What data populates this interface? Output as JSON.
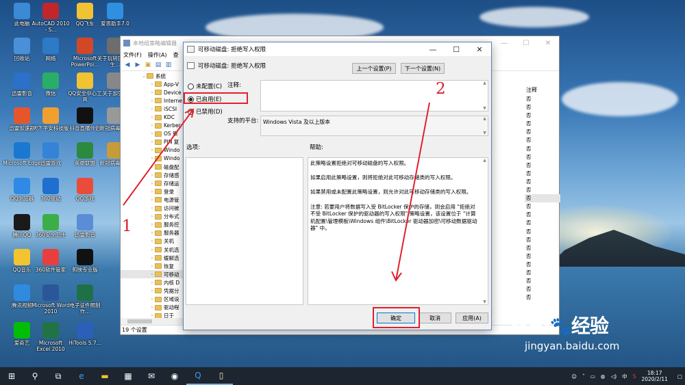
{
  "desktop": {
    "icons": [
      {
        "label": "此电脑",
        "color": "#3a8ad6"
      },
      {
        "label": "AutoCAD 2010 - S...",
        "color": "#c0262c"
      },
      {
        "label": "QQ飞车",
        "color": "#f1c232"
      },
      {
        "label": "爱思助手7.0",
        "color": "#2f8fe0"
      },
      {
        "label": "回收站",
        "color": "#4a90d9"
      },
      {
        "label": "网络",
        "color": "#2d7ac7"
      },
      {
        "label": "Microsoft PowerPoi...",
        "color": "#d24726"
      },
      {
        "label": "关于玩转国际卫生...",
        "color": "#6d6d6d"
      },
      {
        "label": "迅雷影音",
        "color": "#2b70c9"
      },
      {
        "label": "微信",
        "color": "#2aae67"
      },
      {
        "label": "QQ安全中心工具",
        "color": "#f1c232"
      },
      {
        "label": "关于加强...",
        "color": "#888888"
      },
      {
        "label": "迅雷加速器",
        "color": "#e5572a"
      },
      {
        "label": "天下平安科技版",
        "color": "#f0a030"
      },
      {
        "label": "抖音直播伴侣",
        "color": "#111111"
      },
      {
        "label": "新冠病毒疫...",
        "color": "#999999"
      },
      {
        "label": "Microsoft Edge",
        "color": "#1b78d1"
      },
      {
        "label": "迅雷游戏",
        "color": "#3483d6"
      },
      {
        "label": "英雄联盟",
        "color": "#2b8a3e"
      },
      {
        "label": "新冠病毒疫...",
        "color": "#c89b3a"
      },
      {
        "label": "QQ浏览器",
        "color": "#2e8ae6"
      },
      {
        "label": "360驱动",
        "color": "#1e6fcf"
      },
      {
        "label": "QQ游戏",
        "color": "#e94d3a"
      },
      {
        "label": "腾讯QQ",
        "color": "#1a1a1a"
      },
      {
        "label": "360安全卫士",
        "color": "#3cae48"
      },
      {
        "label": "迅雷影音",
        "color": "#5b8dd6"
      },
      {
        "label": "QQ音乐",
        "color": "#f4c430"
      },
      {
        "label": "360软件管家",
        "color": "#e83e3e"
      },
      {
        "label": "剪映专业版",
        "color": "#111111"
      },
      {
        "label": "腾讯视频",
        "color": "#2f8ae0"
      },
      {
        "label": "Microsoft Word 2010",
        "color": "#2b579a"
      },
      {
        "label": "电子证件照制作...",
        "color": "#1e7145"
      },
      {
        "label": "爱奇艺",
        "color": "#00be06"
      },
      {
        "label": "Microsoft Excel 2010",
        "color": "#217346"
      },
      {
        "label": "HiTools 5.7...",
        "color": "#2b5fb8"
      }
    ]
  },
  "bg_window": {
    "title": "本地组策略编辑器",
    "menu": [
      "文件(F)",
      "操作(A)",
      "查"
    ],
    "tree": [
      "系统",
      "App-V",
      "Device",
      "Interne",
      "iSCSI",
      "KDC",
      "Kerber",
      "OS 策",
      "PIN 复",
      "Windo",
      "Windo",
      "磁盘配",
      "存储感",
      "存储运",
      "登录",
      "电源管",
      "访问被",
      "分布式",
      "服务控",
      "服务器",
      "关机",
      "关机选",
      "缓解选",
      "恢复",
      "可移动",
      "内核 D",
      "凭据分",
      "区域设",
      "驱动程",
      "日于"
    ],
    "col_header": "注释",
    "col_values": [
      "否",
      "否",
      "否",
      "否",
      "否",
      "否",
      "否",
      "否",
      "否",
      "否",
      "否",
      "否",
      "否",
      "否",
      "否",
      "否",
      "否",
      "否",
      "否",
      "否",
      "否",
      "否",
      "否",
      "否",
      "否"
    ],
    "status": "19 个设置"
  },
  "dialog": {
    "title": "可移动磁盘: 拒绝写入权限",
    "subtitle": "可移动磁盘: 拒绝写入权限",
    "prev_button": "上一个设置(P)",
    "next_button": "下一个设置(N)",
    "radio_not_configured": "未配置(C)",
    "radio_enabled": "已启用(E)",
    "radio_disabled": "已禁用(D)",
    "comment_label": "注释:",
    "platform_label": "支持的平台:",
    "platform_value": "Windows Vista 及以上版本",
    "options_label": "选项:",
    "help_label": "帮助:",
    "help_paragraphs": [
      "此策略设置拒绝对可移动磁盘的写入权限。",
      "如果启用此策略设置，则将拒绝对此可移动存储类的写入权限。",
      "如果禁用或未配置此策略设置，则允许对此可移动存储类的写入权限。",
      "注意: 若要用户将数据写入受 BitLocker 保护的存储，则会启用 \"拒绝对不受 BitLocker 保护的驱动器的写入权限\" 策略设置，该设置位于 \"计算机配置\\管理模板\\Windows 组件\\BitLocker 驱动器加密\\可移动数据驱动器\" 中。"
    ],
    "ok_button": "确定",
    "cancel_button": "取消",
    "apply_button": "应用(A)",
    "selected_option": "enabled"
  },
  "annotations": {
    "num1": "1",
    "num2": "2"
  },
  "taskbar": {
    "time": "18:17",
    "date": "2020/2/11",
    "lang": "中"
  },
  "watermark": {
    "brand": "Bai",
    "brand_cn": "经验",
    "url": "jingyan.baidu.com"
  },
  "colors": {
    "accent": "#0078d7",
    "annotation_red": "#e0202a",
    "taskbar": "#1c2530"
  }
}
